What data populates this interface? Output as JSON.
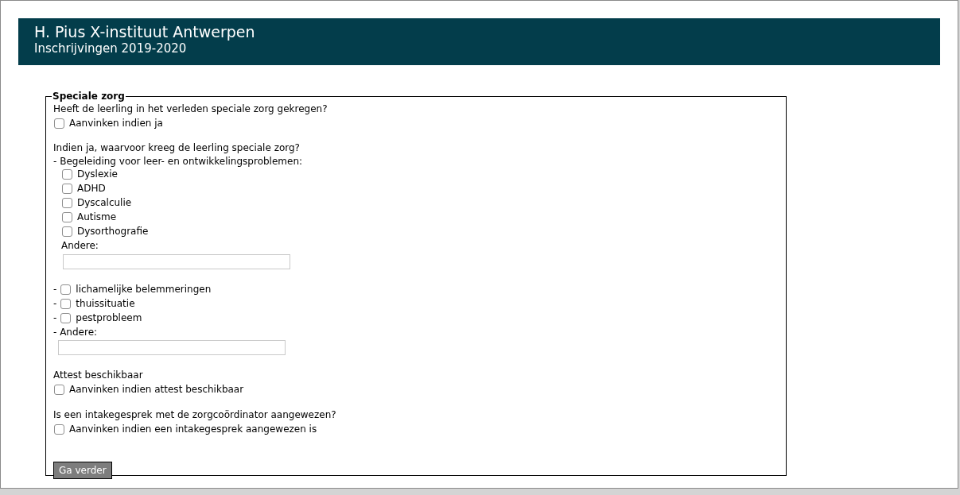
{
  "header": {
    "title": "H. Pius X-instituut Antwerpen",
    "subtitle": "Inschrijvingen 2019-2020"
  },
  "form": {
    "legend": "Speciale zorg",
    "past_care": {
      "question": "Heeft de leerling in het verleden speciale zorg gekregen?",
      "checkbox": {
        "label": "Aanvinken indien ja",
        "checked": false
      }
    },
    "care_reason": {
      "question": "Indien ja, waarvoor kreeg de leerling speciale zorg?",
      "group_label": "- Begeleiding voor leer- en ontwikkelingsproblemen:",
      "options": [
        {
          "label": "Dyslexie",
          "checked": false
        },
        {
          "label": "ADHD",
          "checked": false
        },
        {
          "label": "Dyscalculie",
          "checked": false
        },
        {
          "label": "Autisme",
          "checked": false
        },
        {
          "label": "Dysorthografie",
          "checked": false
        }
      ],
      "other_label": "Andere:",
      "extra_options": [
        {
          "prefix": "-",
          "label": "lichamelijke belemmeringen",
          "checked": false
        },
        {
          "prefix": "-",
          "label": "thuissituatie",
          "checked": false
        },
        {
          "prefix": "-",
          "label": "pestprobleem",
          "checked": false
        }
      ],
      "extra_other_label": "- Andere:"
    },
    "certificate": {
      "question": "Attest beschikbaar",
      "checkbox": {
        "label": "Aanvinken indien attest beschikbaar",
        "checked": false
      }
    },
    "intake": {
      "question": "Is een intakegesprek met de zorgcoördinator aangewezen?",
      "checkbox": {
        "label": "Aanvinken indien een intakegesprek aangewezen is",
        "checked": false
      }
    },
    "submit": "Ga verder"
  }
}
